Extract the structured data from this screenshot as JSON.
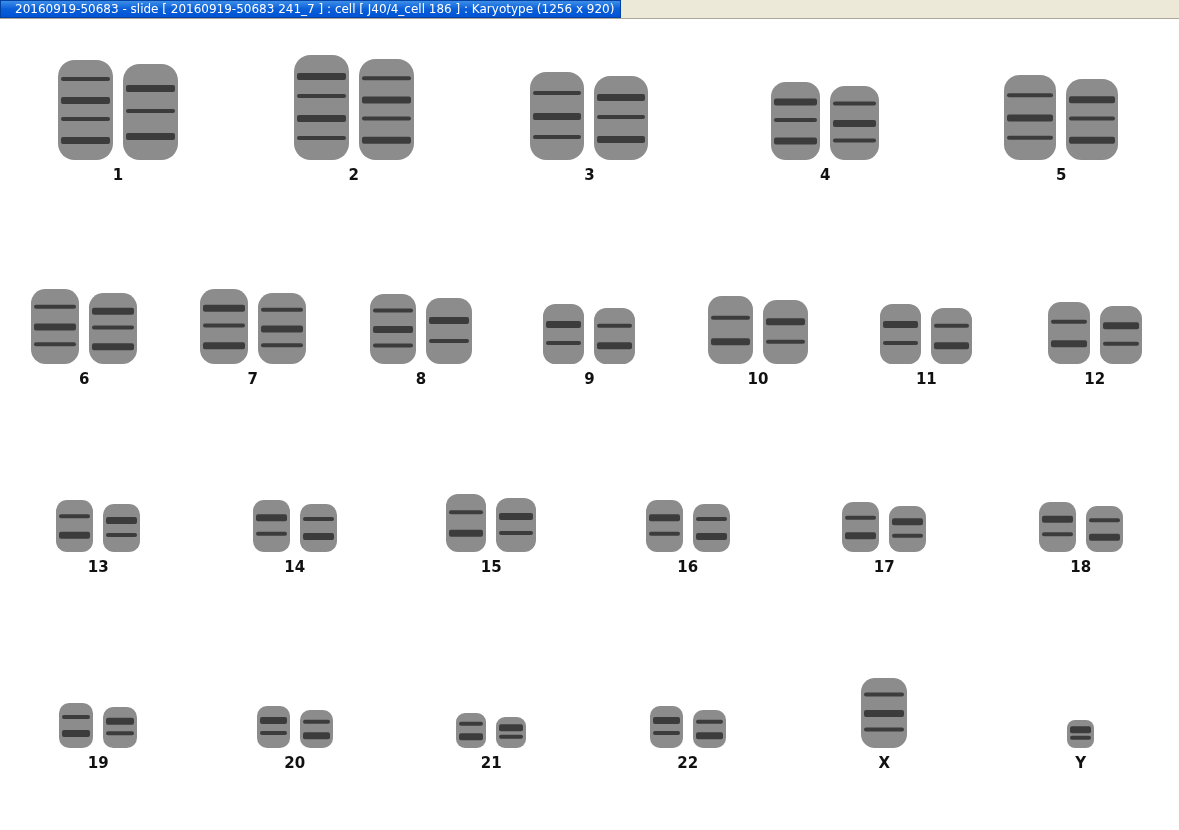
{
  "window": {
    "title": "20160919-50683 - slide [ 20160919-50683 241_7 ] : cell [ J40/4_cell 186 ] : Karyotype  (1256 x 920)"
  },
  "karyotype": {
    "rows": [
      [
        {
          "label": "1",
          "kind": "pair"
        },
        {
          "label": "2",
          "kind": "pair"
        },
        {
          "label": "3",
          "kind": "pair"
        },
        {
          "label": "4",
          "kind": "pair"
        },
        {
          "label": "5",
          "kind": "pair"
        }
      ],
      [
        {
          "label": "6",
          "kind": "pair"
        },
        {
          "label": "7",
          "kind": "pair"
        },
        {
          "label": "8",
          "kind": "pair"
        },
        {
          "label": "9",
          "kind": "pair"
        },
        {
          "label": "10",
          "kind": "pair"
        },
        {
          "label": "11",
          "kind": "pair"
        },
        {
          "label": "12",
          "kind": "pair"
        }
      ],
      [
        {
          "label": "13",
          "kind": "pair"
        },
        {
          "label": "14",
          "kind": "pair"
        },
        {
          "label": "15",
          "kind": "pair"
        },
        {
          "label": "16",
          "kind": "pair"
        },
        {
          "label": "17",
          "kind": "pair"
        },
        {
          "label": "18",
          "kind": "pair"
        }
      ],
      [
        {
          "label": "19",
          "kind": "pair"
        },
        {
          "label": "20",
          "kind": "pair"
        },
        {
          "label": "21",
          "kind": "pair"
        },
        {
          "label": "22",
          "kind": "pair"
        },
        {
          "label": "X",
          "kind": "single"
        },
        {
          "label": "Y",
          "kind": "single"
        }
      ]
    ]
  }
}
